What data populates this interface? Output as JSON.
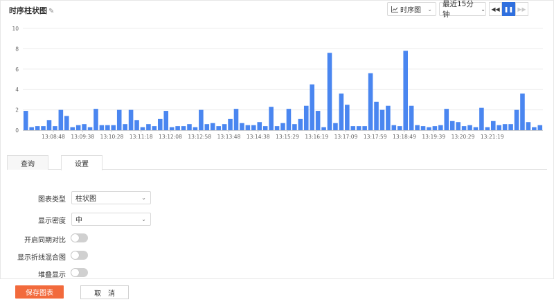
{
  "header": {
    "title": "时序柱状图",
    "edit_icon": "edit-icon",
    "chart_type_label": "时序图",
    "time_range_label": "最近15分钟",
    "playback": {
      "rewind_icon": "rewind-icon",
      "pause_icon": "pause-icon",
      "forward_icon": "fast-forward-icon"
    }
  },
  "chart_data": {
    "type": "bar",
    "ylim": [
      0,
      10
    ],
    "yticks": [
      0,
      2,
      4,
      6,
      8,
      10
    ],
    "bar_color": "#4a86f0",
    "xticks": [
      "13:08:48",
      "13:09:38",
      "13:10:28",
      "13:11:18",
      "13:12:08",
      "13:12:58",
      "13:13:48",
      "13:14:38",
      "13:15:29",
      "13:16:19",
      "13:17:09",
      "13:17:59",
      "13:18:49",
      "13:19:39",
      "13:20:29",
      "13:21:19"
    ],
    "values": [
      1.9,
      0.3,
      0.4,
      0.4,
      1.0,
      0.4,
      2.0,
      1.4,
      0.3,
      0.5,
      0.6,
      0.3,
      2.1,
      0.5,
      0.5,
      0.5,
      2.0,
      0.6,
      2.0,
      1.0,
      0.3,
      0.6,
      0.4,
      1.1,
      1.9,
      0.3,
      0.4,
      0.4,
      0.6,
      0.3,
      2.0,
      0.6,
      0.7,
      0.4,
      0.6,
      1.1,
      2.1,
      0.7,
      0.5,
      0.5,
      0.8,
      0.4,
      2.3,
      0.4,
      0.7,
      2.1,
      0.6,
      1.1,
      2.4,
      4.5,
      1.9,
      0.3,
      7.6,
      0.7,
      3.6,
      2.5,
      0.4,
      0.4,
      0.4,
      5.6,
      2.8,
      2.0,
      2.4,
      0.5,
      0.4,
      7.8,
      2.4,
      0.5,
      0.4,
      0.3,
      0.4,
      0.5,
      2.1,
      0.9,
      0.8,
      0.4,
      0.5,
      0.3,
      2.2,
      0.3,
      0.9,
      0.5,
      0.6,
      0.6,
      2.0,
      3.6,
      0.8,
      0.3,
      0.5
    ],
    "grid": true
  },
  "tabs": [
    {
      "label": "查询",
      "active": false
    },
    {
      "label": "设置",
      "active": true
    }
  ],
  "settings": {
    "chart_type": {
      "label": "图表类型",
      "value": "柱状图"
    },
    "density": {
      "label": "显示密度",
      "value": "中"
    },
    "compare": {
      "label": "开启同期对比",
      "on": false
    },
    "mixed": {
      "label": "显示折线混合图",
      "on": false
    },
    "stacked": {
      "label": "堆叠显示",
      "on": false
    }
  },
  "footer": {
    "save_label": "保存图表",
    "cancel_label": "取　消"
  },
  "colors": {
    "primary": "#f26a3c",
    "accent": "#2f6fde"
  }
}
